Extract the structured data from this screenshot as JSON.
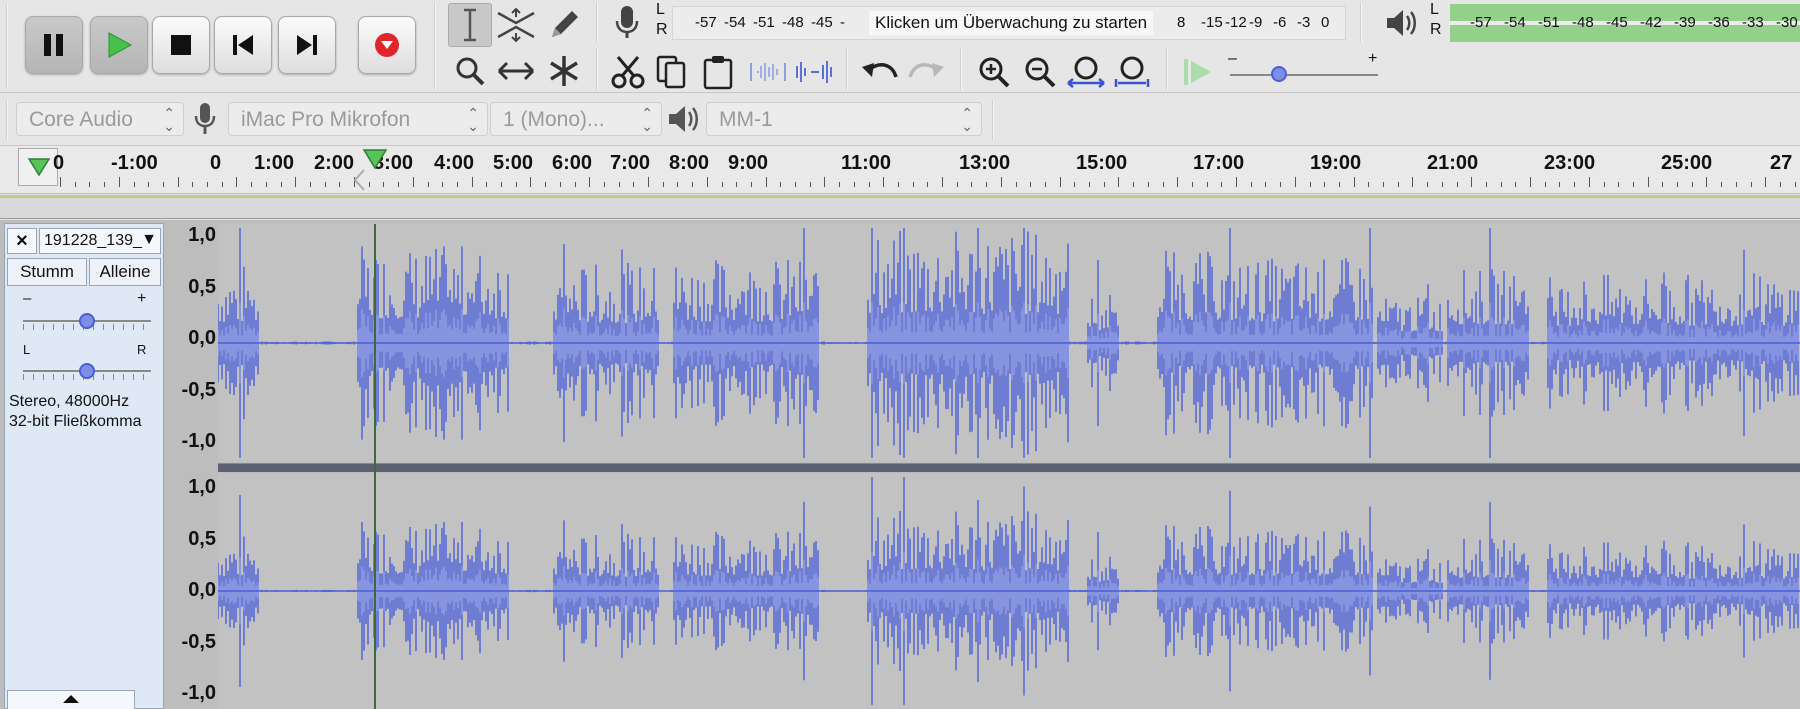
{
  "toolbar": {
    "transport": {
      "pause_icon": "pause-icon",
      "play_icon": "play-icon",
      "stop_icon": "stop-icon",
      "skip_start_icon": "skip-to-start-icon",
      "skip_end_icon": "skip-to-end-icon",
      "record_icon": "record-icon"
    },
    "tools": [
      "selection-tool",
      "envelope-tool",
      "draw-tool",
      "zoom-tool",
      "time-shift-tool",
      "multi-tool"
    ],
    "record_meter": {
      "L": "L",
      "R": "R",
      "scale_left": [
        "-57",
        "-54",
        "-51",
        "-48",
        "-45",
        "-"
      ],
      "monitor_text": "Klicken um Überwachung zu starten",
      "scale_right": [
        "8",
        "-15",
        "-12",
        "-9",
        "-6",
        "-3",
        "0"
      ]
    },
    "play_meter": {
      "L": "L",
      "R": "R",
      "scale": [
        "-57",
        "-54",
        "-51",
        "-48",
        "-45",
        "-42",
        "-39",
        "-36",
        "-33",
        "-30"
      ]
    },
    "playback_speed": {
      "minus": "–",
      "plus": "+",
      "level": 0.33
    },
    "colors": {
      "meter_green": "#93d18a",
      "record_red": "#e0262a",
      "play_green": "#46c04a",
      "wave_blue": "#4a5fd8"
    }
  },
  "devices": {
    "host": "Core Audio",
    "recording_device": "iMac Pro Mikrofon",
    "channels": "1 (Mono)...",
    "playback_device": "MM-1"
  },
  "ruler": {
    "labels": [
      "0",
      "-1:00",
      "0",
      "1:00",
      "2:00",
      "3:00",
      "4:00",
      "5:00",
      "6:00",
      "7:00",
      "8:00",
      "9:00",
      "11:00",
      "13:00",
      "15:00",
      "17:00",
      "19:00",
      "21:00",
      "23:00",
      "25:00",
      "27"
    ]
  },
  "track": {
    "close": "×",
    "name": "191228_139_",
    "mute": "Stumm",
    "solo": "Alleine",
    "gain_minus": "–",
    "gain_plus": "+",
    "pan_left": "L",
    "pan_right": "R",
    "format_line1": "Stereo, 48000Hz",
    "format_line2": "32-bit Fließkomma",
    "collapse_icon": "collapse-up-icon",
    "gain_level": 0.5,
    "pan_level": 0.5,
    "scale_top": [
      "1,0",
      "0,5",
      "0,0",
      "-0,5",
      "-1,0"
    ],
    "scale_bottom": [
      "1,0",
      "0,5",
      "0,0",
      "-0,5",
      "-1,0"
    ]
  }
}
